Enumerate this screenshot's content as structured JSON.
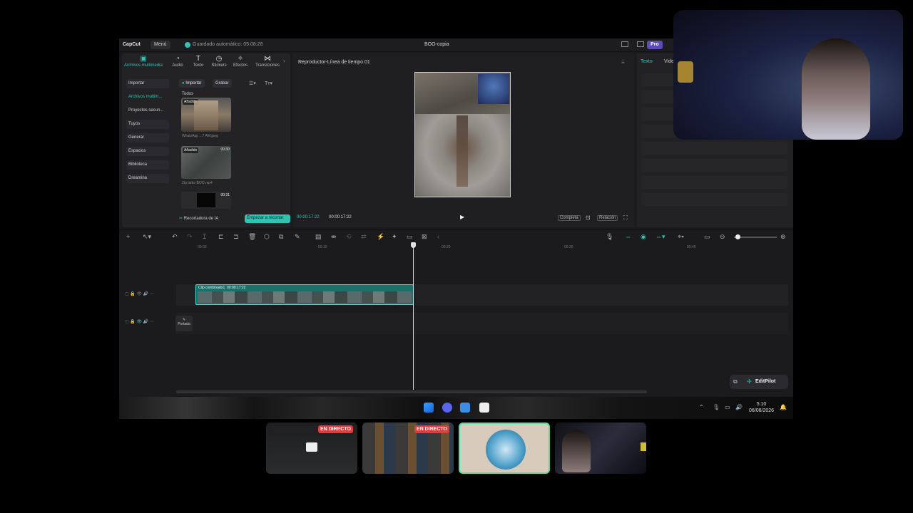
{
  "titlebar": {
    "logo": "CapCut",
    "menu": "Menú",
    "autosave": "Guardado automático: 05:08:28",
    "project": "BOO-copia",
    "pro": "Pro"
  },
  "toolbar": {
    "tools": [
      {
        "label": "Archivos multimedia",
        "icon": "media-icon"
      },
      {
        "label": "Audio",
        "icon": "audio-icon"
      },
      {
        "label": "Texto",
        "icon": "text-icon"
      },
      {
        "label": "Stickers",
        "icon": "sticker-icon"
      },
      {
        "label": "Efectos",
        "icon": "effects-icon"
      },
      {
        "label": "Transiciones",
        "icon": "transitions-icon"
      }
    ]
  },
  "sidebar": {
    "items": [
      "Importar",
      "Archivos multim...",
      "Proyectos secun...",
      "Tuyos",
      "Generar",
      "Espacios",
      "Biblioteca",
      "Dreamina"
    ]
  },
  "media": {
    "import_btn": "Importar",
    "record_btn": "Grabar",
    "filter_all": "Todos",
    "items": [
      {
        "badge": "Añadido",
        "duration": "",
        "name": "WhatsApp ...7 AM.jpeg"
      },
      {
        "badge": "Añadido",
        "duration": "00:30",
        "name": "Zip lartio BOO.mp4"
      },
      {
        "badge": "",
        "duration": "00:31",
        "name": ""
      }
    ],
    "ai_cutter": "Recortadora de IA",
    "start_cut": "Empezar a recortar"
  },
  "player": {
    "title": "Reproductor-Línea de tiempo 01",
    "current_time": "00:00:17:22",
    "total_time": "00:00:17:22",
    "btn_full": "Completa",
    "btn_ratio": "Relación"
  },
  "right_panel": {
    "tabs": [
      "Texto",
      "Vide"
    ]
  },
  "timeline": {
    "ruler": [
      "00:00",
      "00:10",
      "00:20",
      "00:30",
      "00:40"
    ],
    "clip_label": "Clip combinado1",
    "clip_duration": "00:00:17:22",
    "cover_label": "Portada"
  },
  "editpilot": "EditPilot",
  "taskbar": {
    "time": "5:10",
    "date": "06/08/2026"
  },
  "streams": [
    {
      "live": "EN DIRECTO"
    },
    {
      "live": "EN DIRECTO"
    },
    {
      "live": ""
    },
    {
      "live": ""
    }
  ],
  "colors": {
    "accent": "#2fc3b3",
    "live": "#e03c3c",
    "pro": "#5b4bb8"
  }
}
